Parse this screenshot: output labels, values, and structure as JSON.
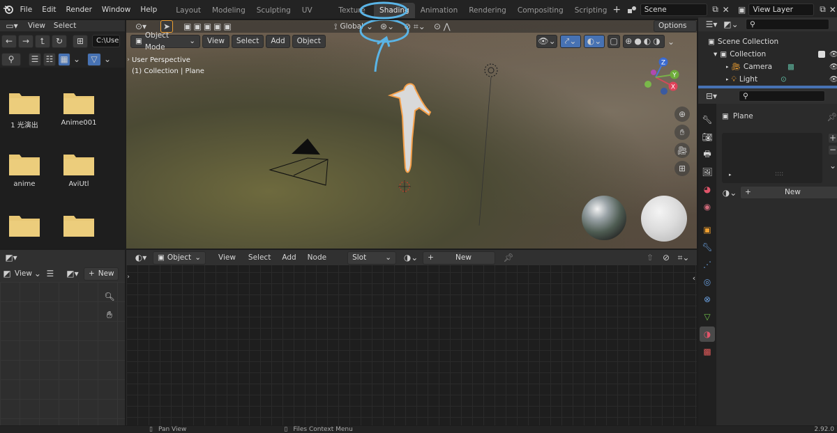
{
  "topbar": {
    "menus": [
      "File",
      "Edit",
      "Render",
      "Window",
      "Help"
    ],
    "workspaces": [
      "Layout",
      "Modeling",
      "Sculpting",
      "UV Editing",
      "Texture Paint",
      "Shading",
      "Animation",
      "Rendering",
      "Compositing",
      "Scripting"
    ],
    "active_workspace": "Shading",
    "scene_label": "Scene",
    "view_layer_label": "View Layer"
  },
  "file_browser": {
    "menus": [
      "View",
      "Select"
    ],
    "path": "C:\\Use",
    "folders": [
      "1 光演出",
      "Anime001",
      "anime",
      "AviUtl",
      "",
      ""
    ]
  },
  "image_editor": {
    "view_label": "View",
    "new_label": "New"
  },
  "viewport": {
    "mode": "Object Mode",
    "menus": [
      "View",
      "Select",
      "Add",
      "Object"
    ],
    "orientation": "Global",
    "options_label": "Options",
    "overlay_line1": "User Perspective",
    "overlay_line2": "(1) Collection | Plane",
    "gizmo": {
      "z": "Z",
      "y": "Y",
      "x": "X"
    }
  },
  "node_editor": {
    "object_label": "Object",
    "menus": [
      "View",
      "Select",
      "Add",
      "Node"
    ],
    "slot_label": "Slot",
    "new_label": "New"
  },
  "outliner": {
    "rows": [
      {
        "label": "Scene Collection",
        "indent": 0
      },
      {
        "label": "Collection",
        "indent": 1
      },
      {
        "label": "Camera",
        "indent": 2
      },
      {
        "label": "Light",
        "indent": 2
      }
    ]
  },
  "properties": {
    "object_name": "Plane",
    "new_label": "New"
  },
  "statusbar": {
    "pan": "Pan View",
    "context": "Files Context Menu",
    "version": "2.92.0"
  },
  "colors": {
    "accent": "#4772b3",
    "annotation": "#5ab4e6",
    "selection_outline": "#f5a04a"
  }
}
